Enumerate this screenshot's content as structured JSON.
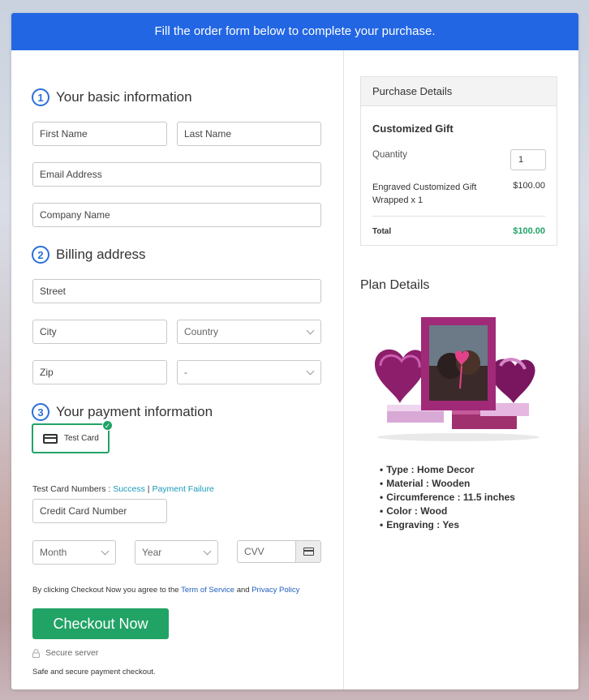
{
  "banner": {
    "text": "Fill the order form below to complete your purchase."
  },
  "sections": {
    "basic": {
      "number": "1",
      "title": "Your basic information"
    },
    "billing": {
      "number": "2",
      "title": "Billing address"
    },
    "payment": {
      "number": "3",
      "title": "Your payment information"
    }
  },
  "fields": {
    "first_name": "First Name",
    "last_name": "Last Name",
    "email": "Email Address",
    "company": "Company Name",
    "street": "Street",
    "city": "City",
    "country": "Country",
    "zip": "Zip",
    "state": "-",
    "card_number": "Credit Card Number",
    "month": "Month",
    "year": "Year",
    "cvv": "CVV"
  },
  "payment": {
    "method_label": "Test Card",
    "test_numbers_label": "Test Card Numbers : ",
    "success": "Success",
    "separator": " | ",
    "failure": "Payment Failure"
  },
  "agreement": {
    "prefix": "By clicking Checkout Now you agree to the ",
    "terms": "Term of Service",
    "and": " and ",
    "privacy": "Privacy Policy"
  },
  "checkout": {
    "button": "Checkout Now",
    "secure": "Secure server",
    "note": "Safe and secure payment checkout."
  },
  "purchase": {
    "header": "Purchase Details",
    "product": "Customized Gift",
    "quantity_label": "Quantity",
    "quantity_value": "1",
    "item_desc": "Engraved Customized Gift Wrapped x 1",
    "item_price": "$100.00",
    "total_label": "Total",
    "total_value": "$100.00"
  },
  "plan": {
    "title": "Plan Details",
    "specs": [
      "Type : Home Decor",
      "Material : Wooden",
      "Circumference : 11.5 inches",
      "Color : Wood",
      "Engraving : Yes"
    ]
  },
  "colors": {
    "banner": "#2266e3",
    "accent_green": "#21a366",
    "step_blue": "#2a6fdc"
  }
}
